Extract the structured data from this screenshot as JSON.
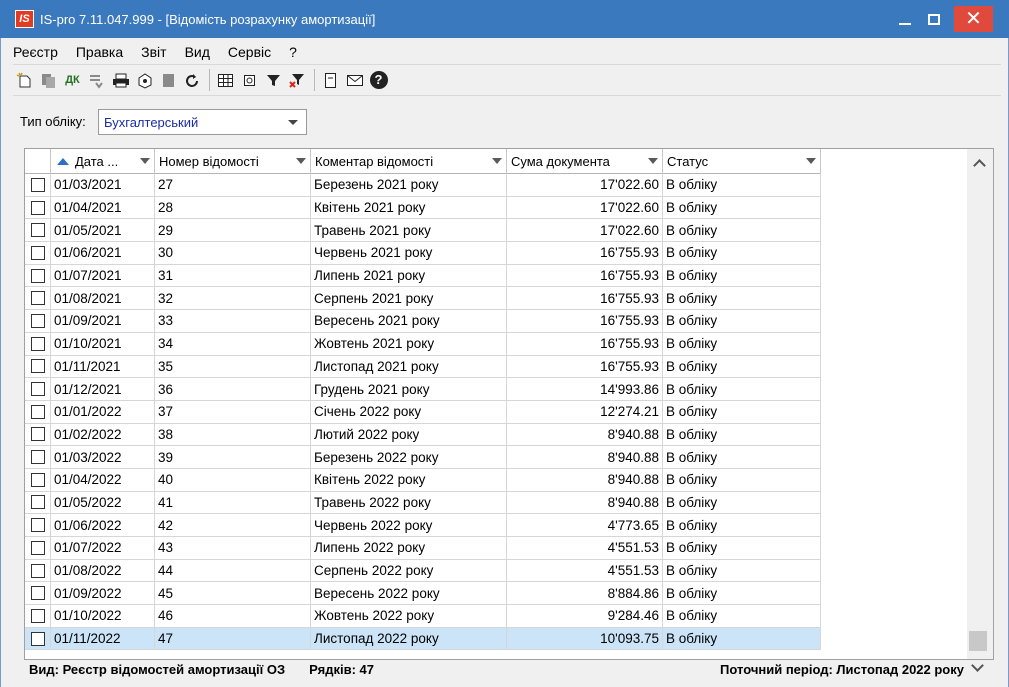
{
  "window": {
    "logo": "IS",
    "title": "IS-pro 7.11.047.999 - [Відомість розрахунку амортизації]",
    "close_glyph": "✕"
  },
  "menu": [
    "Реєстр",
    "Правка",
    "Звіт",
    "Вид",
    "Сервіс",
    "?"
  ],
  "toolbar": {
    "dk_label": "ДК",
    "icons": [
      "new-doc-icon",
      "copy-icon",
      "dk-icon",
      "transfer-icon",
      "print-icon",
      "settings-icon",
      "delete-icon",
      "refresh-icon",
      "table-icon",
      "export-icon",
      "filter-icon",
      "clear-filter-icon",
      "document-icon",
      "mail-icon",
      "help-icon"
    ]
  },
  "filter": {
    "label": "Тип обліку:",
    "value": "Бухгалтерський"
  },
  "grid": {
    "columns": [
      "Дата ...",
      "Номер відомості",
      "Коментар відомості",
      "Сума документа",
      "Статус"
    ],
    "sorted_column": "Дата ...",
    "selected_row": 21,
    "rows": [
      {
        "date": "01/03/2021",
        "number": "27",
        "comment": "Березень 2021 року",
        "sum": "17'022.60",
        "status": "В обліку"
      },
      {
        "date": "01/04/2021",
        "number": "28",
        "comment": "Квітень 2021 року",
        "sum": "17'022.60",
        "status": "В обліку"
      },
      {
        "date": "01/05/2021",
        "number": "29",
        "comment": "Травень 2021 року",
        "sum": "17'022.60",
        "status": "В обліку"
      },
      {
        "date": "01/06/2021",
        "number": "30",
        "comment": "Червень 2021 року",
        "sum": "16'755.93",
        "status": "В обліку"
      },
      {
        "date": "01/07/2021",
        "number": "31",
        "comment": "Липень 2021 року",
        "sum": "16'755.93",
        "status": "В обліку"
      },
      {
        "date": "01/08/2021",
        "number": "32",
        "comment": "Серпень 2021 року",
        "sum": "16'755.93",
        "status": "В обліку"
      },
      {
        "date": "01/09/2021",
        "number": "33",
        "comment": "Вересень 2021 року",
        "sum": "16'755.93",
        "status": "В обліку"
      },
      {
        "date": "01/10/2021",
        "number": "34",
        "comment": "Жовтень 2021 року",
        "sum": "16'755.93",
        "status": "В обліку"
      },
      {
        "date": "01/11/2021",
        "number": "35",
        "comment": "Листопад 2021 року",
        "sum": "16'755.93",
        "status": "В обліку"
      },
      {
        "date": "01/12/2021",
        "number": "36",
        "comment": "Грудень 2021 року",
        "sum": "14'993.86",
        "status": "В обліку"
      },
      {
        "date": "01/01/2022",
        "number": "37",
        "comment": "Січень 2022 року",
        "sum": "12'274.21",
        "status": "В обліку"
      },
      {
        "date": "01/02/2022",
        "number": "38",
        "comment": "Лютий 2022 року",
        "sum": "8'940.88",
        "status": "В обліку"
      },
      {
        "date": "01/03/2022",
        "number": "39",
        "comment": "Березень 2022 року",
        "sum": "8'940.88",
        "status": "В обліку"
      },
      {
        "date": "01/04/2022",
        "number": "40",
        "comment": "Квітень 2022 року",
        "sum": "8'940.88",
        "status": "В обліку"
      },
      {
        "date": "01/05/2022",
        "number": "41",
        "comment": "Травень 2022 року",
        "sum": "8'940.88",
        "status": "В обліку"
      },
      {
        "date": "01/06/2022",
        "number": "42",
        "comment": "Червень 2022 року",
        "sum": "4'773.65",
        "status": "В обліку"
      },
      {
        "date": "01/07/2022",
        "number": "43",
        "comment": "Липень 2022 року",
        "sum": "4'551.53",
        "status": "В обліку"
      },
      {
        "date": "01/08/2022",
        "number": "44",
        "comment": "Серпень 2022 року",
        "sum": "4'551.53",
        "status": "В обліку"
      },
      {
        "date": "01/09/2022",
        "number": "45",
        "comment": "Вересень 2022 року",
        "sum": "8'884.86",
        "status": "В обліку"
      },
      {
        "date": "01/10/2022",
        "number": "46",
        "comment": "Жовтень 2022 року",
        "sum": "9'284.46",
        "status": "В обліку"
      },
      {
        "date": "01/11/2022",
        "number": "47",
        "comment": "Листопад 2022 року",
        "sum": "10'093.75",
        "status": "В обліку"
      }
    ]
  },
  "status": {
    "view": "Вид: Реєстр відомостей амортизації ОЗ",
    "rows_count": "Рядків: 47",
    "period": "Поточний період: Листопад 2022 року"
  },
  "colors": {
    "titlebar": "#3b79bf",
    "close_button": "#e04a3d",
    "selection": "#cce4f7",
    "dropdown_value": "#1a2ca8"
  }
}
